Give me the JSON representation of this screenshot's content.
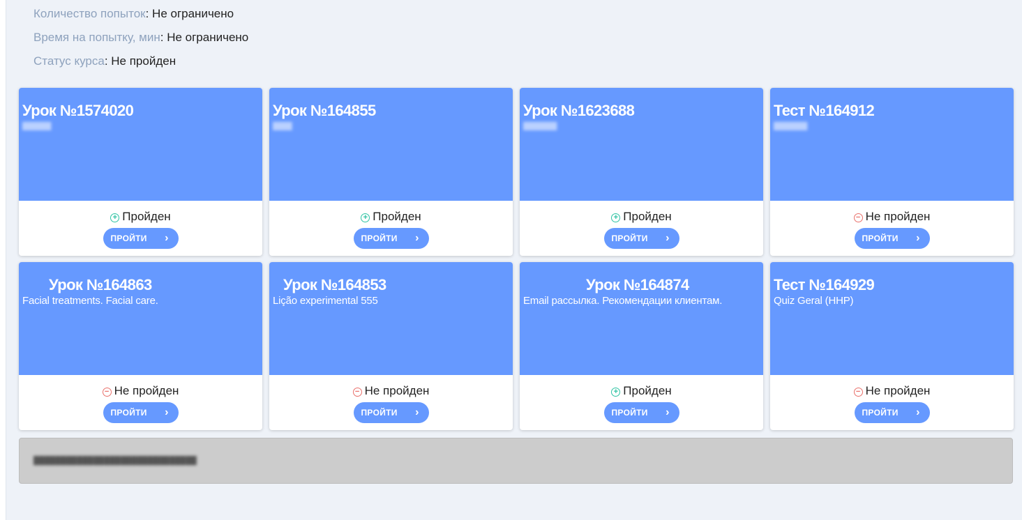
{
  "info": [
    {
      "label": "Количество попыток",
      "value": ": Не ограничено"
    },
    {
      "label": "Время на попытку, мин",
      "value": ": Не ограничено"
    },
    {
      "label": "Статус курса",
      "value": ": Не пройден"
    }
  ],
  "icons": {
    "passed": "plus-circle-icon",
    "failed": "minus-circle-icon",
    "arrow": "chevron-right-icon"
  },
  "colors": {
    "card_header": "#6699ff",
    "passed": "#2ec3a3",
    "failed": "#e9706b",
    "button": "#6699ff"
  },
  "cards": [
    {
      "title": "Урок №1574020",
      "subtitle": "",
      "status": "Пройден",
      "passed": true,
      "button": "ПРОЙТИ"
    },
    {
      "title": "Урок №164855",
      "subtitle": "",
      "status": "Пройден",
      "passed": true,
      "button": "ПРОЙТИ"
    },
    {
      "title": "Урок №1623688",
      "subtitle": "",
      "status": "Пройден",
      "passed": true,
      "button": "ПРОЙТИ"
    },
    {
      "title": "Тест №164912",
      "subtitle": "",
      "status": "Не пройден",
      "passed": false,
      "button": "ПРОЙТИ"
    },
    {
      "title": "Урок №164863",
      "subtitle": "Facial treatments. Facial care.",
      "status": "Не пройден",
      "passed": false,
      "button": "ПРОЙТИ"
    },
    {
      "title": "Урок №164853",
      "subtitle": "Lição experimental 555",
      "status": "Не пройден",
      "passed": false,
      "button": "ПРОЙТИ"
    },
    {
      "title": "Урок №164874",
      "subtitle": "Email рассылка. Рекомендации клиентам.",
      "status": "Пройден",
      "passed": true,
      "button": "ПРОЙТИ"
    },
    {
      "title": "Тест №164929",
      "subtitle": "Quiz Geral (HHP)",
      "status": "Не пройден",
      "passed": false,
      "button": "ПРОЙТИ"
    }
  ],
  "footer": {
    "text": ""
  }
}
